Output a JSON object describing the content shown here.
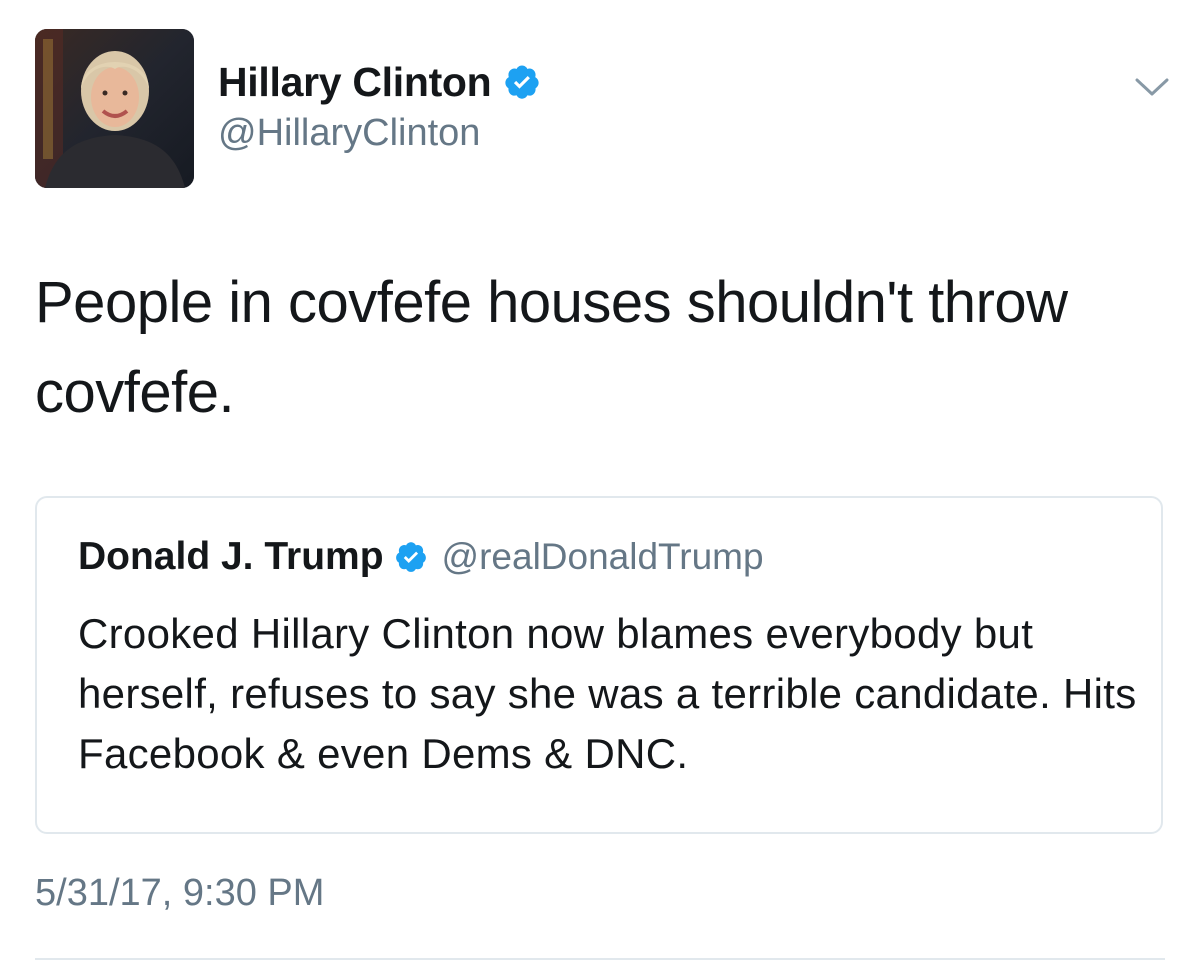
{
  "author": {
    "display_name": "Hillary Clinton",
    "handle": "@HillaryClinton",
    "verified_icon": "verified-badge-icon",
    "avatar": "profile-photo"
  },
  "tweet": {
    "text": "People in covfefe houses shouldn't throw covfefe.",
    "timestamp": "5/31/17, 9:30 PM"
  },
  "quoted_tweet": {
    "display_name": "Donald J. Trump",
    "handle": "@realDonaldTrump",
    "verified_icon": "verified-badge-icon",
    "text": "Crooked Hillary Clinton now blames everybody but herself, refuses to say she was a terrible candidate. Hits Facebook & even Dems & DNC."
  },
  "menu_icon": "chevron-down-icon",
  "colors": {
    "text_primary": "#14171a",
    "text_secondary": "#657786",
    "verified_blue": "#1da1f2",
    "border": "#e1e8ed"
  }
}
